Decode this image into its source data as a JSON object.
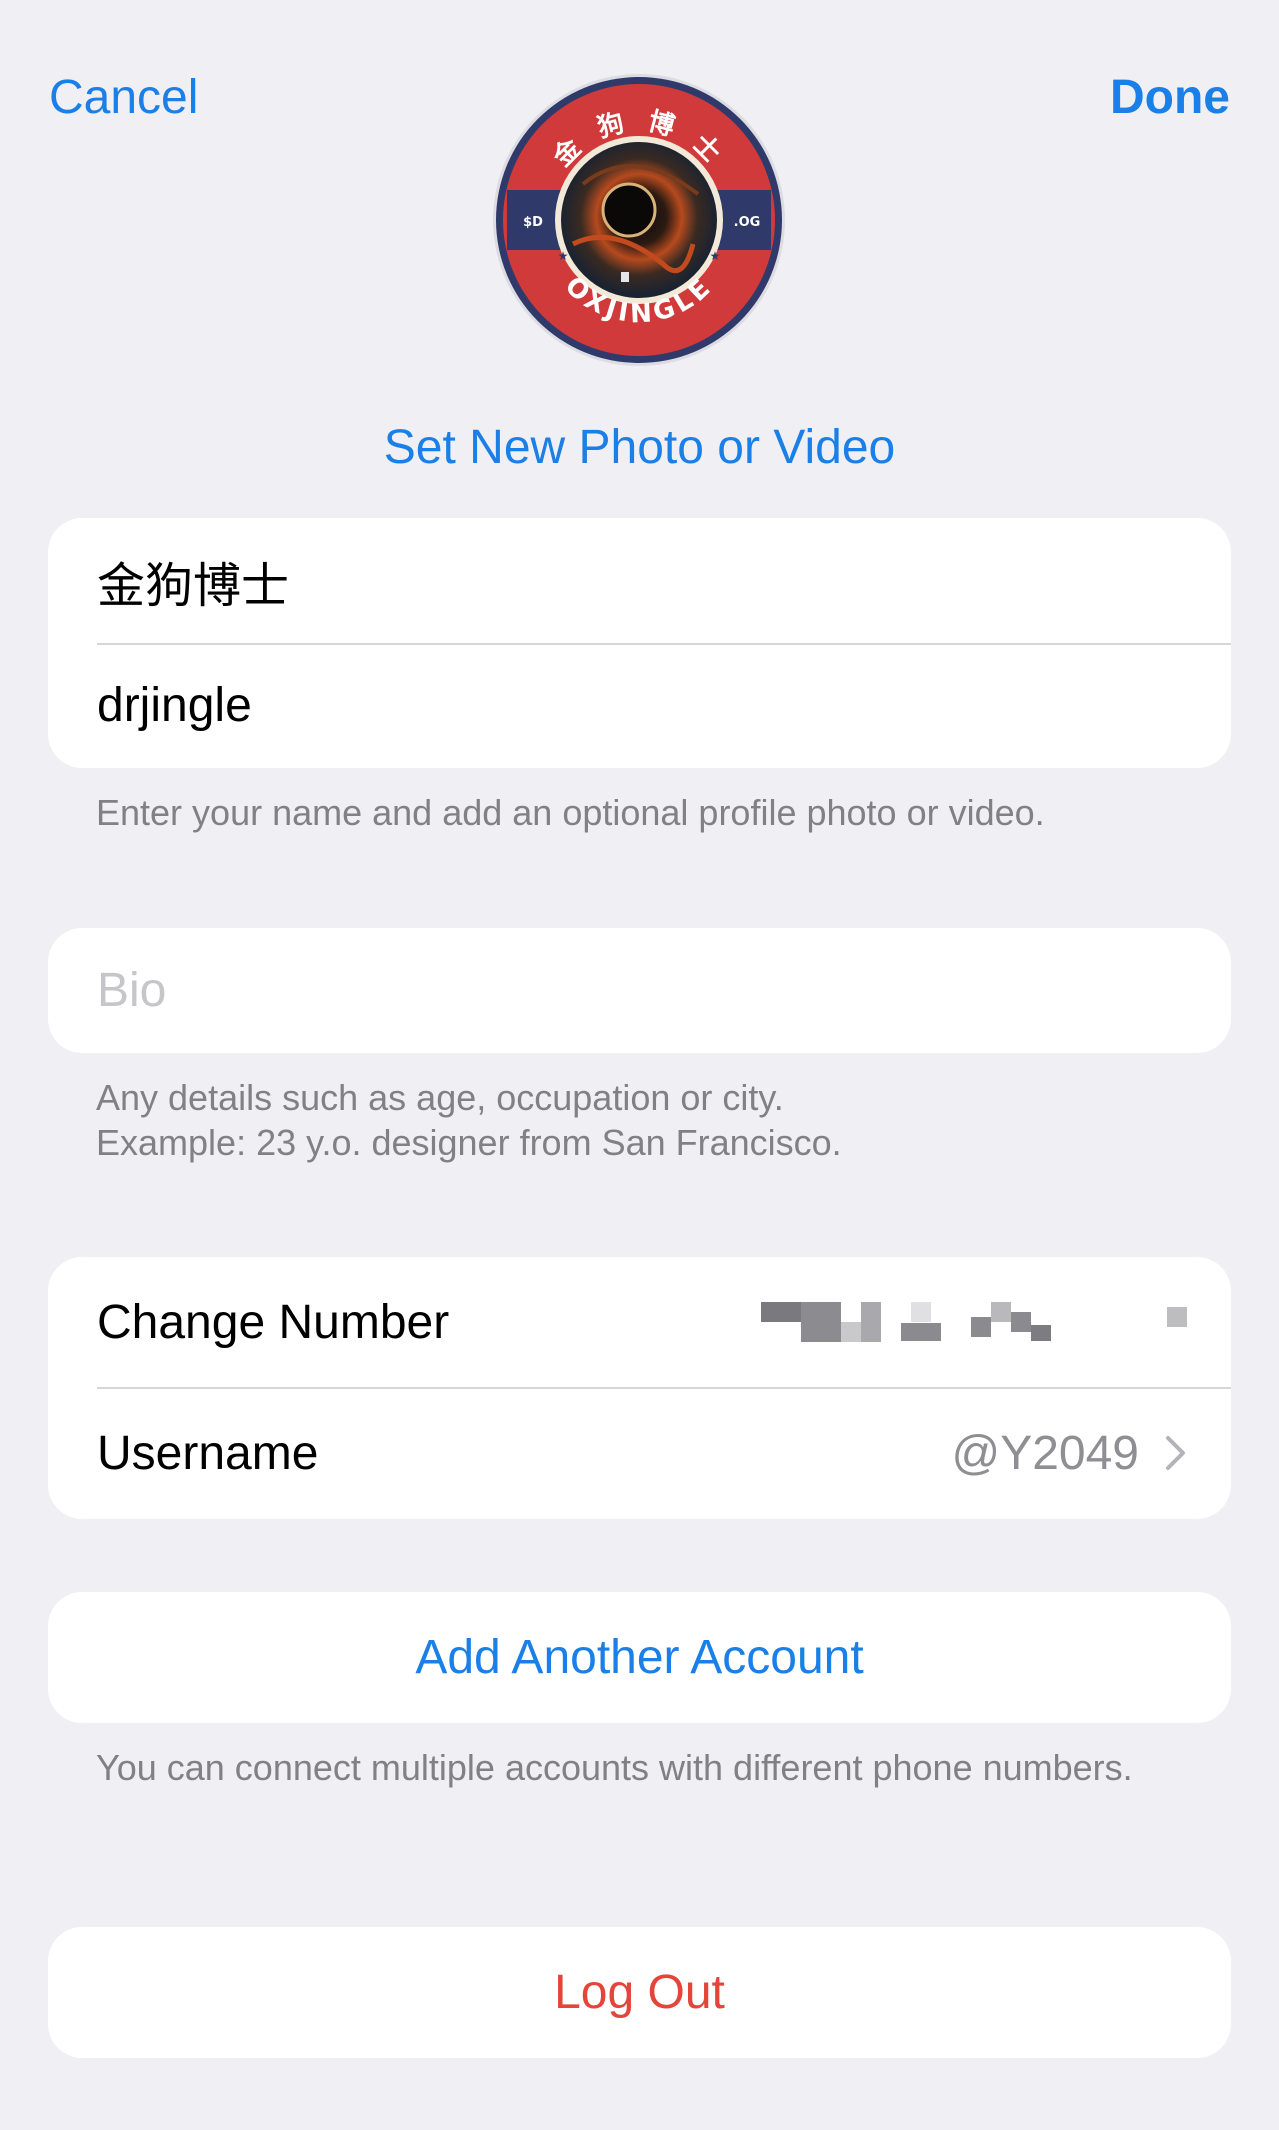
{
  "nav": {
    "cancel_label": "Cancel",
    "done_label": "Done"
  },
  "avatar": {
    "ring_text_top": "金 狗 博 士",
    "ring_text_bottom": "OXJINGLE",
    "side_left": "$D",
    "side_right": ".OG",
    "ring_color": "#d13a3a",
    "band_color": "#2f3a6b"
  },
  "set_photo_label": "Set New Photo or Video",
  "name_card": {
    "first_name": "金狗博士",
    "last_name": "drjingle",
    "note": "Enter your name and add an optional profile photo or video."
  },
  "bio": {
    "placeholder": "Bio",
    "note": "Any details such as age, occupation or city.\nExample: 23 y.o. designer from San Francisco."
  },
  "account": {
    "change_number_label": "Change Number",
    "username_label": "Username",
    "username_value": "@Y2049"
  },
  "add_account": {
    "label": "Add Another Account",
    "note": "You can connect multiple accounts with different phone numbers."
  },
  "logout_label": "Log Out",
  "colors": {
    "accent": "#1a7fe6",
    "destructive": "#e5443b",
    "background": "#efeff4"
  }
}
